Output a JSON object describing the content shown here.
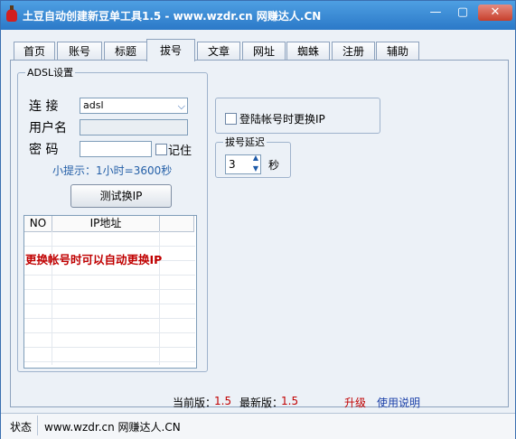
{
  "window": {
    "title": "土豆自动创建新豆单工具1.5 - www.wzdr.cn 网赚达人.CN",
    "min_glyph": "—",
    "max_glyph": "▢",
    "close_glyph": "✕"
  },
  "tabs": [
    "首页",
    "账号",
    "标题",
    "拔号",
    "文章",
    "网址",
    "蜘蛛",
    "注册",
    "辅助"
  ],
  "adsl": {
    "legend": "ADSL设置",
    "connect_label": "连 接",
    "connect_value": "adsl",
    "username_label": "用户名",
    "username_value": "",
    "password_label": "密 码",
    "password_value": "",
    "remember_label": "记住",
    "tip": "小提示：1小时=3600秒",
    "test_button": "测试换IP"
  },
  "table": {
    "columns": [
      "NO",
      "IP地址"
    ],
    "overlay_text": "更换帐号时可以自动更换IP"
  },
  "login_change": {
    "label": "登陆帐号时更换IP"
  },
  "dial_delay": {
    "legend": "拔号延迟",
    "value": "3",
    "unit": "秒"
  },
  "version": {
    "current_label": "当前版：",
    "current_value": "1.5",
    "latest_label": "最新版：",
    "latest_value": "1.5",
    "upgrade_link": "升级",
    "help_link": "使用说明"
  },
  "status": {
    "label": "状态",
    "text": "www.wzdr.cn 网赚达人.CN"
  },
  "colors": {
    "title_bar": "#2b79c8",
    "tip_text": "#2560a8",
    "overlay_text": "#c00000",
    "version_value": "#c00000",
    "upgrade_link": "#c00000",
    "help_link": "#1a3fa8"
  }
}
